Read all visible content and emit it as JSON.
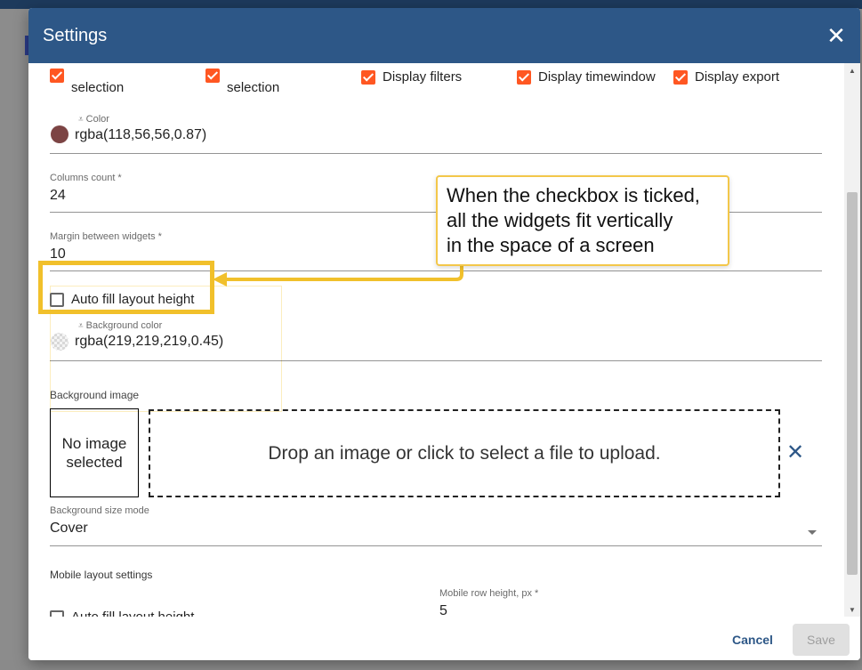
{
  "dialog": {
    "title": "Settings",
    "close_icon": "close-icon"
  },
  "display_options": [
    {
      "label_line1": "",
      "label_line2": "selection",
      "checked": true
    },
    {
      "label_line1": "",
      "label_line2": "selection",
      "checked": true
    },
    {
      "label_line1": "Display filters",
      "label_line2": "",
      "checked": true
    },
    {
      "label_line1": "Display timewindow",
      "label_line2": "",
      "checked": true
    },
    {
      "label_line1": "Display export",
      "label_line2": "",
      "checked": true
    }
  ],
  "color_field": {
    "label": "Color",
    "value": "rgba(118,56,56,0.87)",
    "swatch": "#7c4444"
  },
  "columns_count": {
    "label": "Columns count *",
    "value": "24"
  },
  "margin_field": {
    "label": "Margin between widgets *",
    "value": "10"
  },
  "auto_fill": {
    "label": "Auto fill layout height",
    "checked": false
  },
  "bg_color_field": {
    "label": "Background color",
    "value": "rgba(219,219,219,0.45)"
  },
  "background_image": {
    "label": "Background image",
    "no_image_line1": "No image",
    "no_image_line2": "selected",
    "drop_text": "Drop an image or click to select a file to upload."
  },
  "bg_size_mode": {
    "label": "Background size mode",
    "value": "Cover"
  },
  "mobile": {
    "section_label": "Mobile layout settings",
    "auto_fill_label": "Auto fill layout height",
    "row_height_label": "Mobile row height, px *",
    "row_height_value": "5"
  },
  "footer": {
    "cancel_label": "Cancel",
    "save_label": "Save"
  },
  "callout": {
    "line1": "When the checkbox is ticked,",
    "line2": "all the widgets fit vertically",
    "line3": "in the space of a screen"
  },
  "colors": {
    "header": "#2d5787",
    "checkbox_accent": "#ff5722",
    "highlight": "#f1c02b"
  }
}
